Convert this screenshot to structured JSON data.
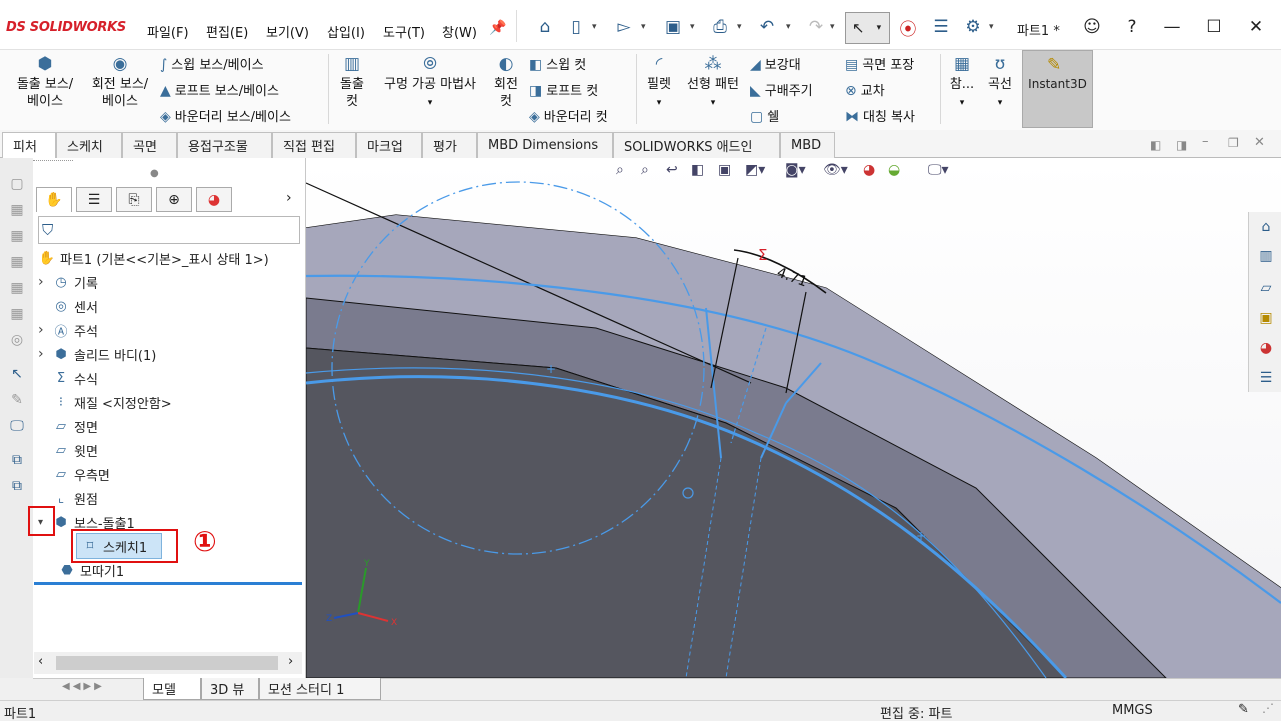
{
  "app": {
    "brand": "SOLIDWORKS",
    "brand_prefix": "DS",
    "doc_title": "파트1 *"
  },
  "menu": [
    "파일(F)",
    "편집(E)",
    "보기(V)",
    "삽입(I)",
    "도구(T)",
    "창(W)"
  ],
  "toolbar_icons": [
    "home-icon",
    "new-file-icon",
    "open-file-icon",
    "save-icon",
    "print-icon",
    "undo-icon",
    "redo-icon",
    "select-icon",
    "traffic-light-icon",
    "file-properties-icon",
    "gear-icon"
  ],
  "window_controls": [
    "user-icon",
    "help-icon",
    "minimize-icon",
    "maximize-icon",
    "close-icon"
  ],
  "ribbon": {
    "boss_extrude": "돌출 보스/\n베이스",
    "boss_revolve": "회전 보스/\n베이스",
    "swept_boss": "스윕 보스/베이스",
    "loft_boss": "로프트 보스/베이스",
    "boundary_boss": "바운더리 보스/베이스",
    "extruded_cut": "돌출\n컷",
    "hole_wizard": "구멍 가공 마법사",
    "revolved_cut": "회전\n컷",
    "swept_cut": "스윕 컷",
    "lofted_cut": "로프트 컷",
    "boundary_cut": "바운더리 컷",
    "fillet": "필렛",
    "linear_pattern": "선형 패턴",
    "rib": "보강대",
    "draft": "구배주기",
    "shell": "쉘",
    "wrap": "곡면 포장",
    "intersect": "교차",
    "mirror": "대칭 복사",
    "reference": "참...",
    "curves": "곡선",
    "instant3d": "Instant3D"
  },
  "tabs": [
    "피처",
    "스케치",
    "곡면",
    "용접구조물",
    "직접 편집",
    "마크업",
    "평가",
    "MBD Dimensions",
    "SOLIDWORKS 애드인",
    "MBD"
  ],
  "active_tab": "피처",
  "feature_tree": {
    "root": "파트1  (기본<<기본>_표시 상태 1>)",
    "items": [
      {
        "label": "기록",
        "icon": "history-icon",
        "expandable": true
      },
      {
        "label": "센서",
        "icon": "sensor-icon",
        "expandable": false
      },
      {
        "label": "주석",
        "icon": "annotation-icon",
        "expandable": true
      },
      {
        "label": "솔리드 바디(1)",
        "icon": "solid-body-icon",
        "expandable": true
      },
      {
        "label": "수식",
        "icon": "equation-icon",
        "expandable": false
      },
      {
        "label": "재질 <지정안함>",
        "icon": "material-icon",
        "expandable": false
      },
      {
        "label": "정면",
        "icon": "plane-icon",
        "expandable": false
      },
      {
        "label": "윗면",
        "icon": "plane-icon",
        "expandable": false
      },
      {
        "label": "우측면",
        "icon": "plane-icon",
        "expandable": false
      },
      {
        "label": "원점",
        "icon": "origin-icon",
        "expandable": false
      },
      {
        "label": "보스-돌출1",
        "icon": "extrude-icon",
        "expandable": true
      }
    ],
    "child": "스케치1",
    "after": "모따기1"
  },
  "annotation_number": "①",
  "dimension_value": "4.71",
  "dimension_symbol": "Σ",
  "bottom_tabs": [
    "모델",
    "3D 뷰",
    "모션 스터디 1"
  ],
  "status": {
    "left": "파트1",
    "mode": "편집 중: 파트",
    "units": "MMGS"
  },
  "colors": {
    "accent_red": "#e01010",
    "sketch_blue": "#4a9ae8",
    "selection": "#cce4f7"
  }
}
